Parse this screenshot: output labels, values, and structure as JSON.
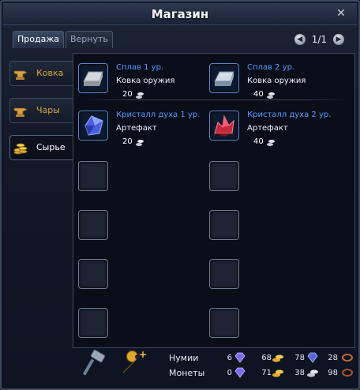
{
  "window": {
    "title": "Магазин"
  },
  "tabs": [
    {
      "label": "Продажа",
      "active": true
    },
    {
      "label": "Вернуть",
      "active": false
    }
  ],
  "pager": {
    "text": "1/1"
  },
  "sidebar": [
    {
      "label": "Ковка",
      "icon": "anvil-icon",
      "active": false
    },
    {
      "label": "Чары",
      "icon": "anvil-icon",
      "active": false
    },
    {
      "label": "Сырье",
      "icon": "coins-icon",
      "active": true
    }
  ],
  "items": [
    {
      "name": "Сплав 1 ур.",
      "category": "Ковка оружия",
      "price": "20",
      "icon": "alloy-ingot-icon"
    },
    {
      "name": "Сплав 2 ур.",
      "category": "Ковка оружия",
      "price": "40",
      "icon": "alloy-ingot-icon"
    },
    {
      "name": "Кристалл духа 1 ур.",
      "category": "Артефакт",
      "price": "20",
      "icon": "blue-crystal-icon"
    },
    {
      "name": "Кристалл духа 2 ур.",
      "category": "Артефакт",
      "price": "40",
      "icon": "red-crystal-icon"
    }
  ],
  "currency": {
    "numi_label": "Нумии",
    "coins_label": "Монеты",
    "numi": [
      "6",
      "68",
      "78",
      "28"
    ],
    "coins": [
      "0",
      "71",
      "38",
      "98"
    ]
  },
  "colors": {
    "item_name": "#4f9cff",
    "side_label": "#d9a53a"
  }
}
